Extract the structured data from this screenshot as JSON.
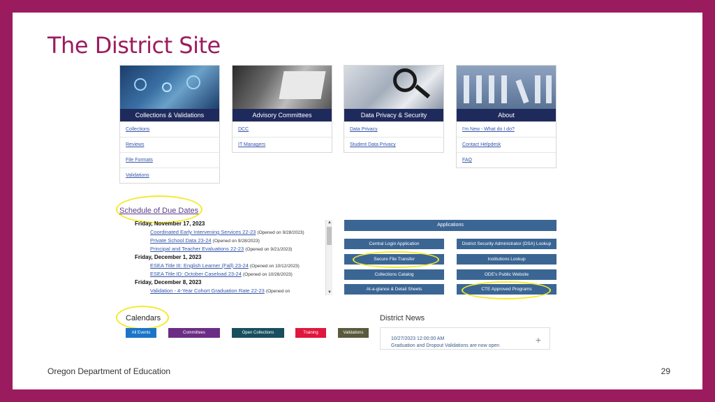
{
  "slide": {
    "title": "The District Site",
    "footer_org": "Oregon Department of Education",
    "page_number": "29"
  },
  "cards": [
    {
      "heading": "Collections & Validations",
      "links": [
        "Collections",
        "Reviews",
        "File Formats",
        "Validations"
      ]
    },
    {
      "heading": "Advisory Committees",
      "links": [
        "DCC",
        "IT Managers"
      ]
    },
    {
      "heading": "Data Privacy & Security",
      "links": [
        "Data Privacy",
        "Student Data Privacy"
      ]
    },
    {
      "heading": "About",
      "links": [
        "I'm New - What do I do?",
        "Contact Helpdesk",
        "FAQ"
      ]
    }
  ],
  "schedule": {
    "link": "Schedule of Due Dates",
    "groups": [
      {
        "date": "Friday, November 17, 2023",
        "items": [
          {
            "title": "Coordinated Early Intervening Services 22-23",
            "note": "(Opened on 9/28/2023)"
          },
          {
            "title": "Private School Data 23-24",
            "note": "(Opened on 9/28/2023)"
          },
          {
            "title": "Principal and Teacher Evaluations 22-23",
            "note": "(Opened on 9/21/2023)"
          }
        ]
      },
      {
        "date": "Friday, December 1, 2023",
        "items": [
          {
            "title": "ESEA Title III: English Learner (Fall) 23-24",
            "note": "(Opened on 10/12/2023)"
          },
          {
            "title": "ESEA Title ID: October Caseload 23-24",
            "note": "(Opened on 10/26/2023)"
          }
        ]
      },
      {
        "date": "Friday, December 8, 2023",
        "items": [
          {
            "title": "Validation - 4-Year Cohort Graduation Rate 22-23",
            "note": "(Opened on"
          }
        ]
      }
    ]
  },
  "applications": {
    "header": "Applications",
    "buttons": [
      "Central Login Application",
      "District Security Administrator (DSA) Lookup",
      "Secure File Transfer",
      "Institutions Lookup",
      "Collections Catalog",
      "ODE's Public Website",
      "At-a-glance & Detail Sheets",
      "CTE Approved Programs"
    ]
  },
  "calendars": {
    "title": "Calendars",
    "buttons": [
      {
        "label": "All Events",
        "color": "#1a75c9"
      },
      {
        "label": "Committees",
        "color": "#6b2d84"
      },
      {
        "label": "Open Collections",
        "color": "#174f5f"
      },
      {
        "label": "Training",
        "color": "#e0173c"
      },
      {
        "label": "Validations",
        "color": "#5a5a3c"
      }
    ]
  },
  "news": {
    "title": "District News",
    "date": "10/27/2023 12:00:00 AM",
    "headline": "Graduation and Dropout Validations are now open",
    "expand_icon": "plus-icon"
  },
  "colors": {
    "frame": "#9b1c5e",
    "card_header": "#1f2a5c",
    "app_button": "#3b6694",
    "highlight": "#f4ea2a"
  }
}
